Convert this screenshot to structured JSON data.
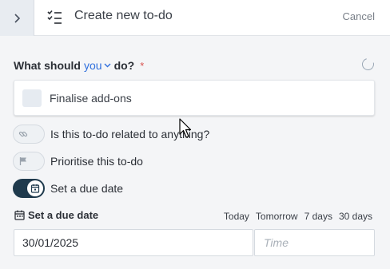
{
  "header": {
    "title": "Create new to-do",
    "cancel_label": "Cancel",
    "expand_icon": "chevron-right-icon",
    "todo_icon": "checklist-icon"
  },
  "question": {
    "prefix": "What should",
    "assignee": "you",
    "suffix": "do?",
    "required_mark": "*"
  },
  "todo": {
    "text": "Finalise add-ons"
  },
  "toggles": [
    {
      "label": "Is this to-do related to anything?",
      "icon": "link-icon",
      "on": false
    },
    {
      "label": "Prioritise this to-do",
      "icon": "flag-icon",
      "on": false
    },
    {
      "label": "Set a due date",
      "icon": "calendar-icon",
      "on": true
    }
  ],
  "due_date": {
    "title": "Set a due date",
    "quick_options": [
      "Today",
      "Tomorrow",
      "7 days",
      "30 days"
    ],
    "date_value": "30/01/2025",
    "time_placeholder": "Time"
  },
  "colors": {
    "accent": "#2f6fdd",
    "toggle_on": "#1f3a4d",
    "required": "#d9534f"
  }
}
